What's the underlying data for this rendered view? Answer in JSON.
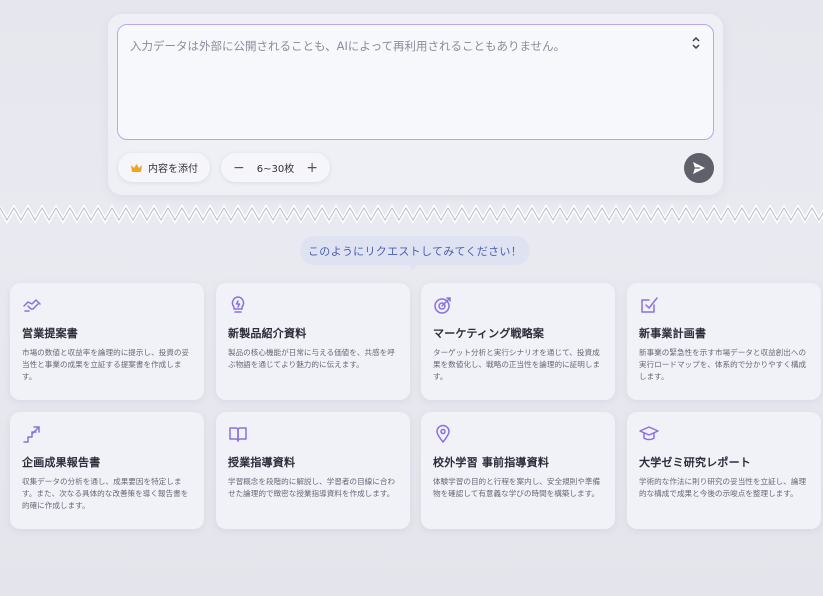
{
  "composer": {
    "placeholder": "入力データは外部に公開されることも、AIによって再利用されることもありません。",
    "attach_label": "内容を添付",
    "pages_label": "6~30枚",
    "minus_symbol": "−",
    "plus_symbol": "+"
  },
  "request_prompt": "このようにリクエストしてみてください！",
  "colors": {
    "accent": "#8b6fe0",
    "pill_text": "#4b5fb1",
    "send_button": "#5f6069"
  },
  "cards": [
    {
      "icon": "handshake-icon",
      "title": "営業提案書",
      "description": "市場の数値と収益率を論理的に提示し、投資の妥当性と事業の成果を立証する提案書を作成します。"
    },
    {
      "icon": "lightbulb-icon",
      "title": "新製品紹介資料",
      "description": "製品の核心機能が日常に与える価値を、共感を呼ぶ物語を通じてより魅力的に伝えます。"
    },
    {
      "icon": "target-icon",
      "title": "マーケティング戦略案",
      "description": "ターゲット分析と実行シナリオを通じて、投資成果を数値化し、戦略の正当性を論理的に証明します。"
    },
    {
      "icon": "checklist-icon",
      "title": "新事業計画書",
      "description": "新事業の緊急性を示す市場データと収益創出への実行ロードマップを、体系的で分かりやすく構成します。"
    },
    {
      "icon": "growth-steps-icon",
      "title": "企画成果報告書",
      "description": "収集データの分析を通し、成果要因を特定します。また、次なる具体的な改善策を導く報告書を的確に作成します。"
    },
    {
      "icon": "open-book-icon",
      "title": "授業指導資料",
      "description": "学習概念を段階的に解説し、学習者の目線に合わせた論理的で緻密な授業指導資料を作成します。"
    },
    {
      "icon": "location-pin-icon",
      "title": "校外学習 事前指導資料",
      "description": "体験学習の目的と行程を案内し、安全規則や準備物を確認して有意義な学びの時間を構築します。"
    },
    {
      "icon": "graduation-cap-icon",
      "title": "大学ゼミ研究レポート",
      "description": "学術的な作法に則り研究の妥当性を立証し、論理的な構成で成果と今後の示唆点を整理します。"
    }
  ]
}
